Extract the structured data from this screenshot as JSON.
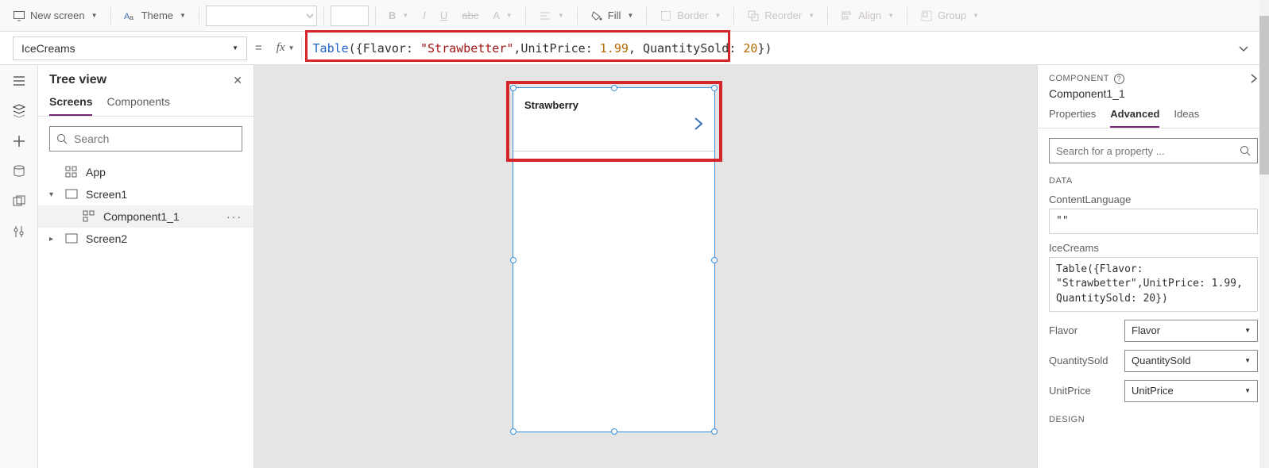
{
  "ribbon": {
    "newScreen": "New screen",
    "theme": "Theme",
    "bold": "B",
    "italic": "I",
    "underline": "U",
    "strike": "abc",
    "fontColor": "A",
    "align": "",
    "fill": "Fill",
    "border": "Border",
    "reorder": "Reorder",
    "alignBtn": "Align",
    "group": "Group"
  },
  "formula": {
    "property": "IceCreams",
    "fx": "fx",
    "kw": "Table",
    "open": "({Flavor: ",
    "str": "\"Strawbetter\"",
    "mid": ",UnitPrice: ",
    "num1": "1.99",
    "mid2": ", QuantitySold: ",
    "num2": "20",
    "close": "})"
  },
  "tree": {
    "title": "Tree view",
    "tabScreens": "Screens",
    "tabComponents": "Components",
    "searchPlaceholder": "Search",
    "app": "App",
    "screen1": "Screen1",
    "component": "Component1_1",
    "screen2": "Screen2"
  },
  "canvas": {
    "rowLabel": "Strawberry"
  },
  "right": {
    "heading": "COMPONENT",
    "name": "Component1_1",
    "tabProperties": "Properties",
    "tabAdvanced": "Advanced",
    "tabIdeas": "Ideas",
    "searchPlaceholder": "Search for a property ...",
    "sectionData": "DATA",
    "contentLanguageLabel": "ContentLanguage",
    "contentLanguageValue": "\"\"",
    "iceCreamsLabel": "IceCreams",
    "iceCreamsValue": "Table({Flavor: \"Strawbetter\",UnitPrice: 1.99, QuantitySold: 20})",
    "flavorLabel": "Flavor",
    "flavorValue": "Flavor",
    "qtyLabel": "QuantitySold",
    "qtyValue": "QuantitySold",
    "priceLabel": "UnitPrice",
    "priceValue": "UnitPrice",
    "sectionDesign": "DESIGN"
  }
}
